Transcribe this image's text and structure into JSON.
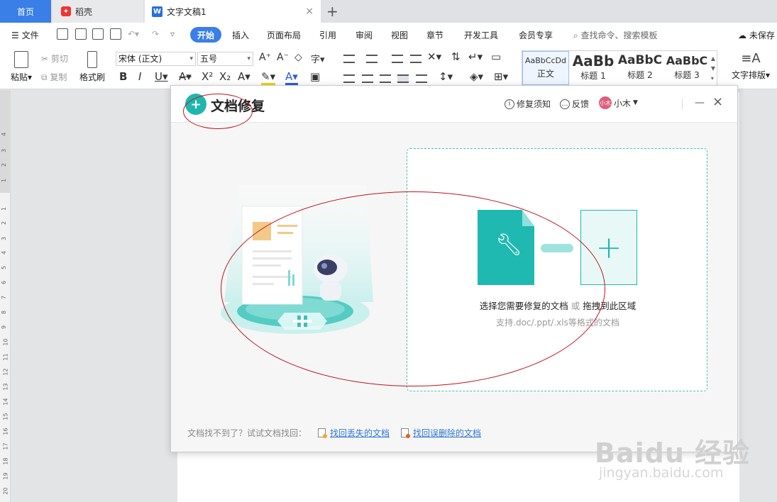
{
  "tabs": {
    "home": "首页",
    "daoke": "稻壳",
    "doc": "文字文稿1",
    "add": "+",
    "close": "×"
  },
  "menu": {
    "file": "文件",
    "start": "开始",
    "items": [
      "插入",
      "页面布局",
      "引用",
      "审阅",
      "视图",
      "章节",
      "开发工具",
      "会员专享"
    ],
    "search": "查找命令、搜索模板",
    "cloud": "未保存"
  },
  "ribbon": {
    "paste": "粘贴",
    "cut": "剪切",
    "copy": "复制",
    "format_painter": "格式刷",
    "font": "宋体 (正文)",
    "size": "五号",
    "styles": [
      {
        "sample": "AaBbCcDd",
        "name": "正文"
      },
      {
        "sample": "AaBb",
        "name": "标题 1"
      },
      {
        "sample": "AaBbC",
        "name": "标题 2"
      },
      {
        "sample": "AaBbC",
        "name": "标题 3"
      }
    ],
    "text_layout": "文字排版"
  },
  "ruler_numbers": [
    "4",
    "3",
    "2",
    "1",
    "1",
    "2",
    "3",
    "4",
    "5",
    "6",
    "7",
    "8",
    "9",
    "10",
    "11",
    "12",
    "13",
    "14",
    "15",
    "16",
    "17",
    "18",
    "19",
    "20"
  ],
  "dialog": {
    "title": "文档修复",
    "notice": "修复须知",
    "feedback": "反馈",
    "user": "小木",
    "dropzone_main": "选择您需要修复的文档",
    "dropzone_or": "或",
    "dropzone_drag": "拖拽到此区域",
    "dropzone_sub": "支持.doc/.ppt/.xls等格式的文档",
    "footer_prompt": "文档找不到了？试试文档找回：",
    "footer_link1": "找回丢失的文档",
    "footer_link2": "找回误删除的文档"
  },
  "watermark": {
    "brand": "Baidu 经验",
    "url": "jingyan.baidu.com"
  },
  "colors": {
    "accent": "#3a7ee8",
    "teal": "#21b6ad",
    "annotation": "#c0141e"
  }
}
